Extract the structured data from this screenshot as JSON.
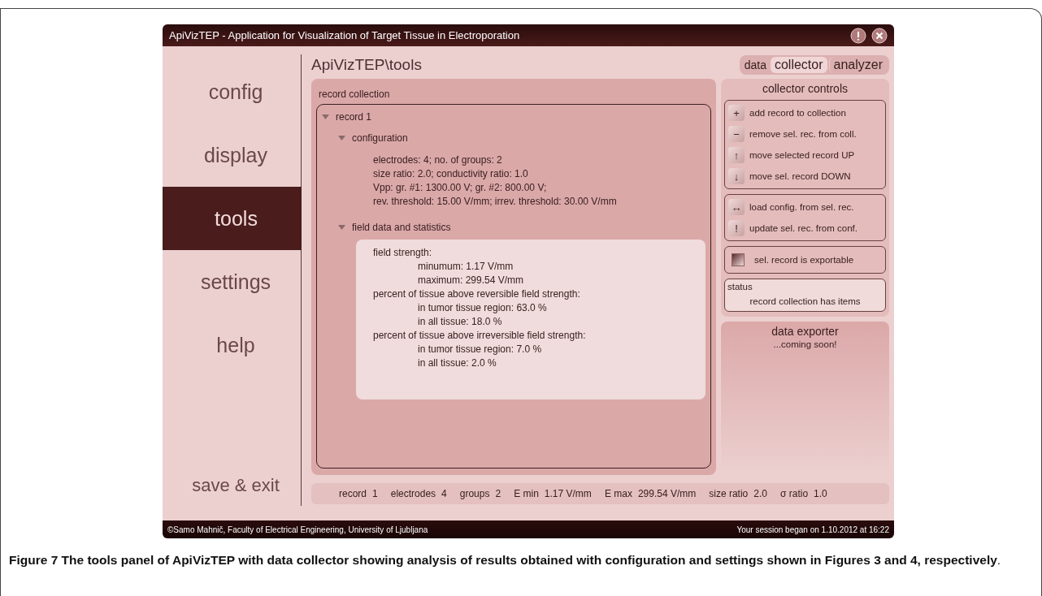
{
  "window": {
    "title": "ApiVizTEP - Application for Visualization of Target Tissue in Electroporation"
  },
  "sidebar": {
    "items": [
      {
        "label": "config",
        "selected": false
      },
      {
        "label": "display",
        "selected": false
      },
      {
        "label": "tools",
        "selected": true
      },
      {
        "label": "settings",
        "selected": false
      },
      {
        "label": "help",
        "selected": false
      }
    ],
    "exit": "save & exit"
  },
  "path": "ApiVizTEP\\tools",
  "tab_group_label": "data",
  "tabs": [
    {
      "label": "collector",
      "selected": true
    },
    {
      "label": "analyzer",
      "selected": false
    }
  ],
  "record_collection": {
    "title": "record collection",
    "tree": [
      {
        "label": "record 1",
        "expanded": true,
        "children": [
          {
            "label": "configuration",
            "expanded": true,
            "boxed": false,
            "lines": [
              {
                "text": "electrodes: 4; no. of groups: 2"
              },
              {
                "text": "size ratio: 2.0; conductivity ratio: 1.0"
              },
              {
                "text": "Vpp: gr. #1: 1300.00 V; gr. #2: 800.00 V;"
              },
              {
                "text": "rev. threshold: 15.00 V/mm; irrev. threshold: 30.00 V/mm"
              }
            ]
          },
          {
            "label": "field data and statistics",
            "expanded": true,
            "boxed": true,
            "lines": [
              {
                "text": "field strength:",
                "children": [
                  {
                    "text": "minumum: 1.17 V/mm"
                  },
                  {
                    "text": "maximum: 299.54 V/mm"
                  }
                ]
              },
              {
                "text": "percent of tissue above reversible field strength:",
                "children": [
                  {
                    "text": "in tumor tissue region: 63.0 %"
                  },
                  {
                    "text": "in all tissue: 18.0 %"
                  }
                ]
              },
              {
                "text": "percent of tissue above irreversible field strength:",
                "children": [
                  {
                    "text": "in tumor tissue region: 7.0 %"
                  },
                  {
                    "text": "in all tissue: 2.0 %"
                  }
                ]
              }
            ]
          }
        ]
      }
    ]
  },
  "collector_controls": {
    "title": "collector controls",
    "groups": [
      [
        {
          "icon": "+",
          "label": "add record to collection"
        },
        {
          "icon": "−",
          "label": "remove sel. rec. from coll."
        },
        {
          "icon": "↑",
          "label": "move selected record UP"
        },
        {
          "icon": "↓",
          "label": "move sel. record DOWN"
        }
      ],
      [
        {
          "icon": "↔",
          "label": "load config. from sel. rec."
        },
        {
          "icon": "!",
          "label": "update sel. rec. from conf."
        }
      ]
    ],
    "exportable": {
      "label": "sel. record is exportable",
      "checked": true
    },
    "status": {
      "title": "status",
      "text": "record collection has items"
    }
  },
  "data_exporter": {
    "title": "data exporter",
    "text": "...coming soon!"
  },
  "info_bar": [
    {
      "label": "record",
      "value": "1"
    },
    {
      "label": "electrodes",
      "value": "4"
    },
    {
      "label": "groups",
      "value": "2"
    },
    {
      "label": "E min",
      "value": "1.17 V/mm"
    },
    {
      "label": "E max",
      "value": "299.54 V/mm"
    },
    {
      "label": "size ratio",
      "value": "2.0"
    },
    {
      "label": "σ ratio",
      "value": "1.0"
    }
  ],
  "footer": {
    "left": "©Samo Mahnič, Faculty of Electrical Engineering, University of Ljubljana",
    "right": "Your session began on 1.10.2012 at 16:22"
  },
  "caption": "**Figure 7 The tools panel of ApiVizTEP with data collector showing analysis of results obtained with configuration and settings shown in Figures 3 and 4, respectively**."
}
